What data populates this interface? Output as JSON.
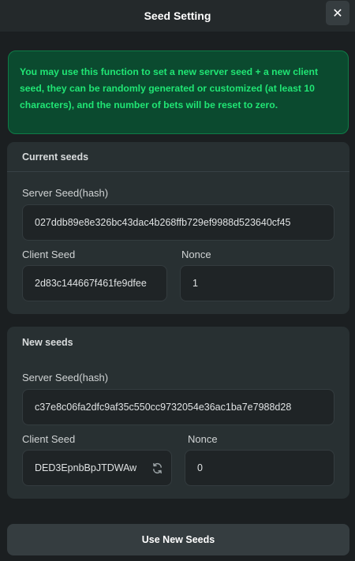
{
  "header": {
    "title": "Seed Setting",
    "close_symbol": "✕"
  },
  "notice": {
    "text": "You may use this function to set a new server seed + a new client seed, they can be randomly generated or customized (at least 10 characters), and the number of bets will be reset to zero."
  },
  "current_seeds": {
    "title": "Current seeds",
    "server_seed_label": "Server Seed(hash)",
    "server_seed_value": "027ddb89e8e326bc43dac4b268ffb729ef9988d523640cf45",
    "client_seed_label": "Client Seed",
    "client_seed_value": "2d83c144667f461fe9dfee",
    "nonce_label": "Nonce",
    "nonce_value": "1"
  },
  "new_seeds": {
    "title": "New seeds",
    "server_seed_label": "Server Seed(hash)",
    "server_seed_value": "c37e8c06fa2dfc9af35c550cc9732054e36ac1ba7e7988d28",
    "client_seed_label": "Client Seed",
    "client_seed_value": "DED3EpnbBpJTDWAw",
    "refresh_icon": "refresh-icon",
    "nonce_label": "Nonce",
    "nonce_value": "0"
  },
  "actions": {
    "use_new_seeds_label": "Use New Seeds"
  },
  "colors": {
    "background": "#1b1f21",
    "panel": "#283032",
    "notice_bg": "#0b4a2f",
    "notice_text": "#20e574"
  }
}
